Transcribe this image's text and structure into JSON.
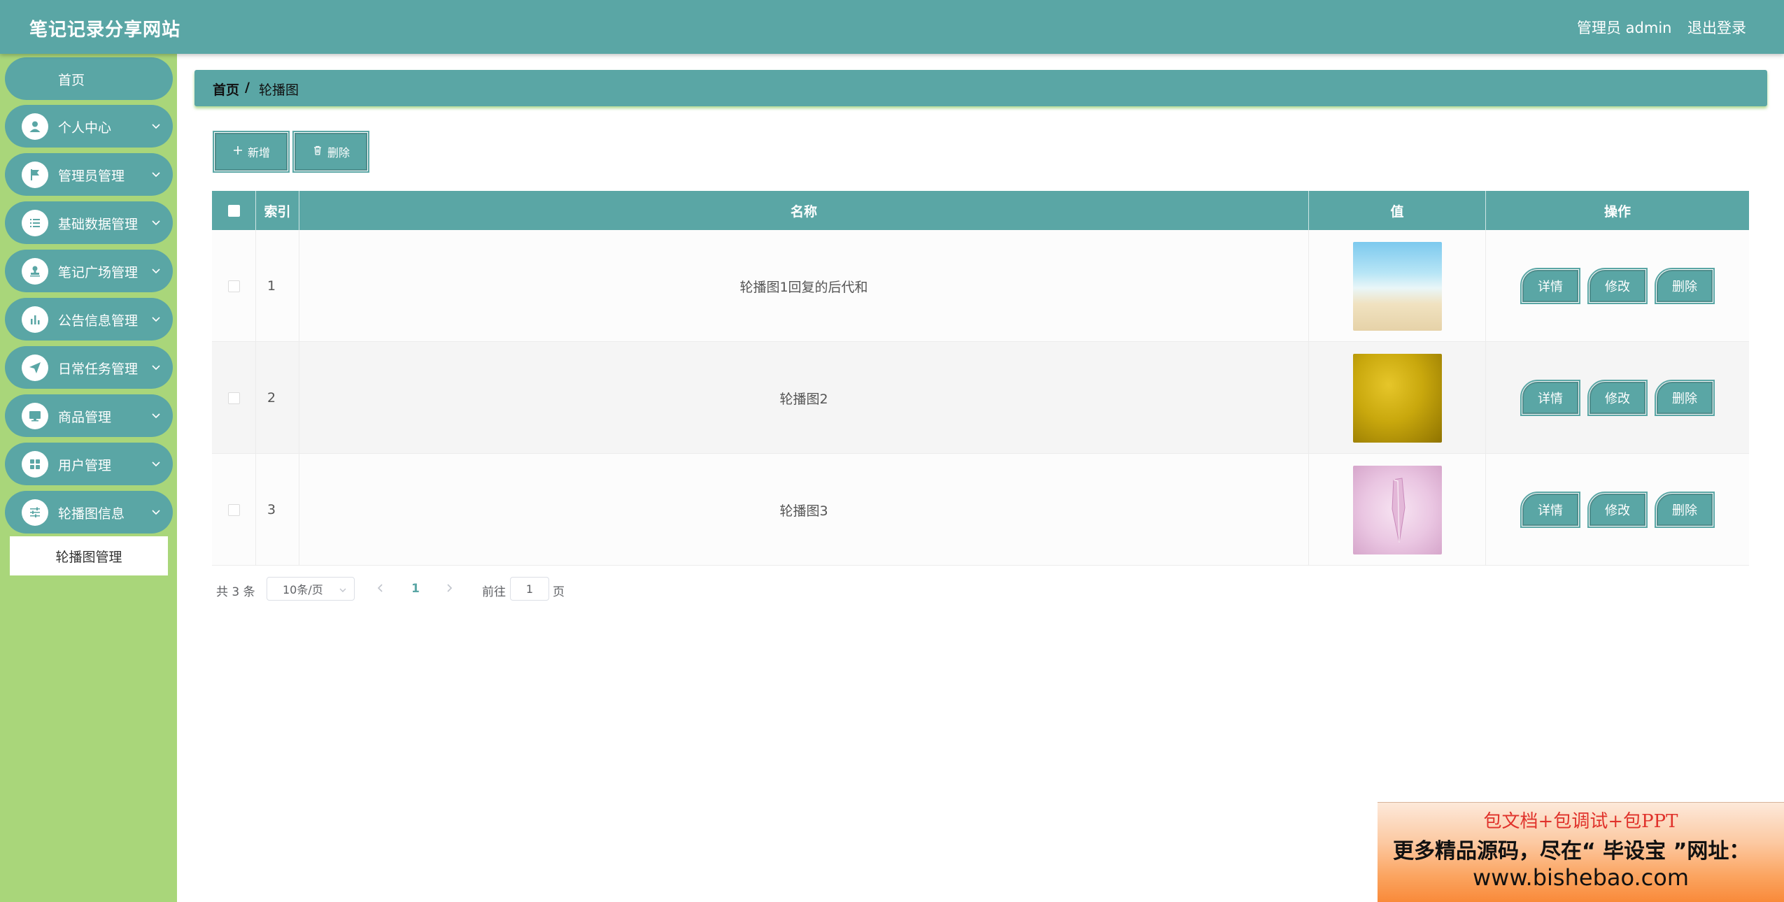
{
  "header": {
    "brand": "笔记记录分享网站",
    "admin_label": "管理员 admin",
    "logout": "退出登录"
  },
  "sidebar": {
    "home": "首页",
    "items": [
      {
        "label": "个人中心",
        "icon": "user-icon"
      },
      {
        "label": "管理员管理",
        "icon": "flag-icon"
      },
      {
        "label": "基础数据管理",
        "icon": "list-icon"
      },
      {
        "label": "笔记广场管理",
        "icon": "stamp-icon"
      },
      {
        "label": "公告信息管理",
        "icon": "bar-chart-icon"
      },
      {
        "label": "日常任务管理",
        "icon": "send-icon"
      },
      {
        "label": "商品管理",
        "icon": "monitor-icon"
      },
      {
        "label": "用户管理",
        "icon": "grid-icon"
      },
      {
        "label": "轮播图信息",
        "icon": "sliders-icon"
      }
    ],
    "submenu": "轮播图管理"
  },
  "breadcrumb": {
    "home": "首页",
    "separator": "/",
    "current": "轮播图"
  },
  "toolbar": {
    "add": "新增",
    "delete": "删除"
  },
  "table": {
    "headers": {
      "index": "索引",
      "name": "名称",
      "value": "值",
      "actions": "操作"
    },
    "rows": [
      {
        "index": "1",
        "name": "轮播图1回复的后代和",
        "image": "beach"
      },
      {
        "index": "2",
        "name": "轮播图2",
        "image": "yellow-cloth"
      },
      {
        "index": "3",
        "name": "轮播图3",
        "image": "pink-crystal"
      }
    ],
    "row_actions": {
      "detail": "详情",
      "edit": "修改",
      "delete": "删除"
    }
  },
  "pagination": {
    "total": "共 3 条",
    "page_size": "10条/页",
    "current_page": "1",
    "goto_label": "前往",
    "goto_value": "1",
    "page_suffix": "页"
  },
  "ad": {
    "line1": "包文档+包调试+包PPT",
    "line2": "更多精品源码，尽在“ 毕设宝 ”网址：",
    "line3": "www.bishebao.com"
  },
  "colors": {
    "primary": "#5aa6a5",
    "sidebar_bg": "#a9d67a",
    "accent_text": "#e0322b"
  }
}
